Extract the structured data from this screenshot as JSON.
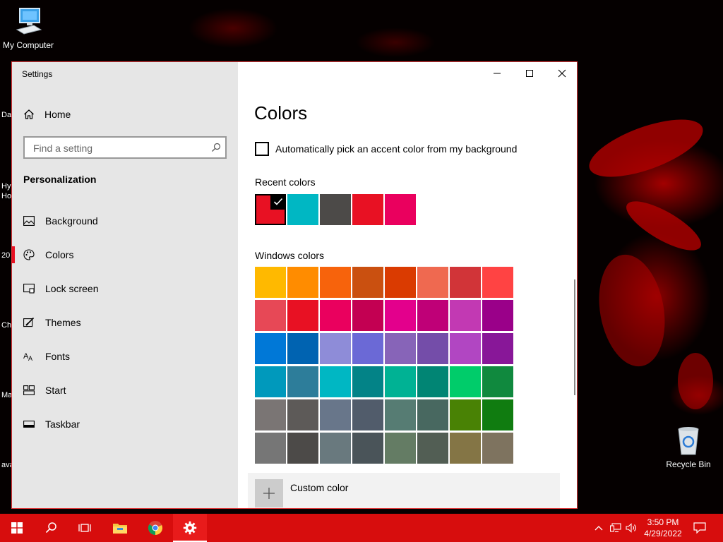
{
  "desktop": {
    "icons": [
      {
        "label": "My Computer"
      },
      {
        "label": "Recycle Bin"
      }
    ],
    "edge_labels": [
      "Da",
      "Hy",
      "Ho",
      "20",
      "Ch",
      "Ma",
      "ava"
    ]
  },
  "window": {
    "title": "Settings",
    "controls": [
      "minimize",
      "maximize",
      "close"
    ]
  },
  "sidebar": {
    "home_label": "Home",
    "search_placeholder": "Find a setting",
    "section_title": "Personalization",
    "items": [
      {
        "label": "Background",
        "icon": "picture-icon",
        "active": false
      },
      {
        "label": "Colors",
        "icon": "palette-icon",
        "active": true
      },
      {
        "label": "Lock screen",
        "icon": "lock-screen-icon",
        "active": false
      },
      {
        "label": "Themes",
        "icon": "themes-icon",
        "active": false
      },
      {
        "label": "Fonts",
        "icon": "fonts-icon",
        "active": false
      },
      {
        "label": "Start",
        "icon": "start-icon",
        "active": false
      },
      {
        "label": "Taskbar",
        "icon": "taskbar-icon",
        "active": false
      }
    ]
  },
  "main": {
    "page_title": "Colors",
    "auto_accent_label": "Automatically pick an accent color from my background",
    "auto_accent_checked": false,
    "recent_colors_heading": "Recent colors",
    "recent_colors": [
      "#e81123",
      "#00b7c3",
      "#4c4a48",
      "#e81123",
      "#ea005e"
    ],
    "recent_selected_index": 0,
    "windows_colors_heading": "Windows colors",
    "windows_colors": [
      [
        "#ffb900",
        "#ff8c00",
        "#f7630c",
        "#ca5010",
        "#da3b01",
        "#ef6950",
        "#d13438",
        "#ff4343"
      ],
      [
        "#e74856",
        "#e81123",
        "#ea005e",
        "#c30052",
        "#e3008c",
        "#bf0077",
        "#c239b3",
        "#9a0089"
      ],
      [
        "#0078d7",
        "#0063b1",
        "#8e8cd8",
        "#6b69d6",
        "#8764b8",
        "#744da9",
        "#b146c2",
        "#881798"
      ],
      [
        "#0099bc",
        "#2d7d9a",
        "#00b7c3",
        "#038387",
        "#00b294",
        "#018574",
        "#00cc6a",
        "#10893e"
      ],
      [
        "#7a7574",
        "#5d5a58",
        "#68768a",
        "#515c6b",
        "#567c73",
        "#486860",
        "#498205",
        "#107c10"
      ],
      [
        "#767676",
        "#4c4a48",
        "#69797e",
        "#4a5459",
        "#647c64",
        "#525e54",
        "#847545",
        "#7e735f"
      ]
    ],
    "custom_color_label": "Custom color"
  },
  "taskbar": {
    "apps": [
      "start-button",
      "search",
      "task-view",
      "file-explorer",
      "chrome",
      "settings"
    ],
    "active_app": "settings",
    "clock_time": "3:50 PM",
    "clock_date": "4/29/2022"
  },
  "colors": {
    "accent": "#e81123",
    "taskbar": "#d70d0d",
    "sidebar_bg": "#e6e6e6"
  }
}
